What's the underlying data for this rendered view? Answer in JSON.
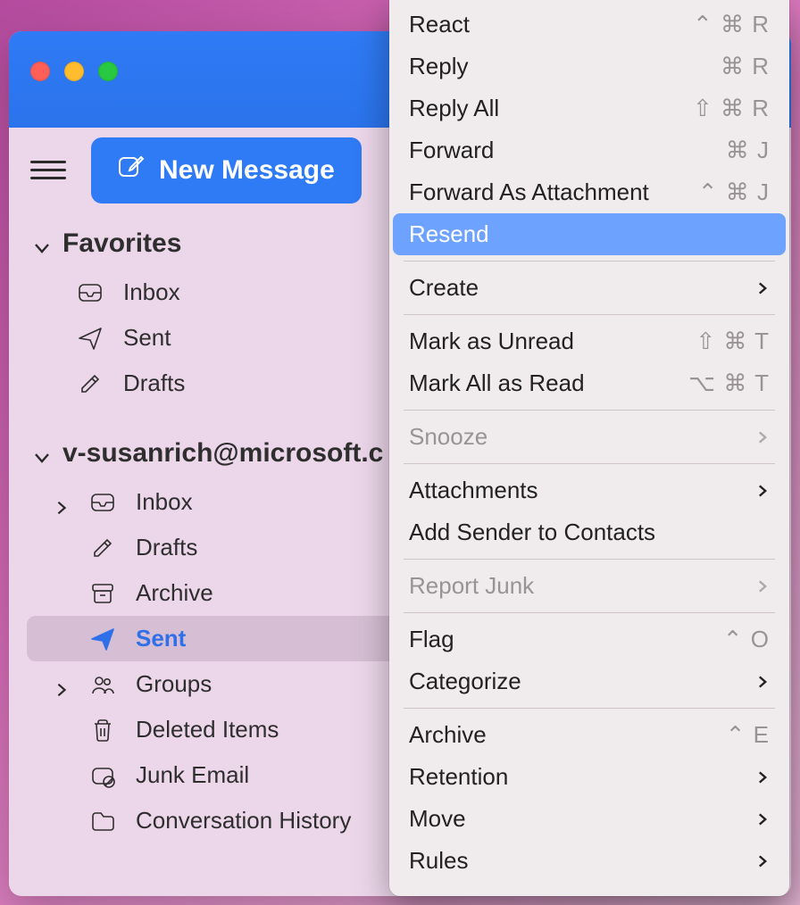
{
  "toolbar": {
    "new_message_label": "New Message"
  },
  "sidebar": {
    "favorites_label": "Favorites",
    "favorites": [
      {
        "label": "Inbox",
        "icon": "inbox"
      },
      {
        "label": "Sent",
        "icon": "sent"
      },
      {
        "label": "Drafts",
        "icon": "drafts"
      }
    ],
    "account_label": "v-susanrich@microsoft.c",
    "account_items": [
      {
        "label": "Inbox",
        "icon": "inbox",
        "chevron": true
      },
      {
        "label": "Drafts",
        "icon": "drafts"
      },
      {
        "label": "Archive",
        "icon": "archive"
      },
      {
        "label": "Sent",
        "icon": "sent",
        "selected": true
      },
      {
        "label": "Groups",
        "icon": "groups",
        "chevron": true
      },
      {
        "label": "Deleted Items",
        "icon": "trash"
      },
      {
        "label": "Junk Email",
        "icon": "junk"
      },
      {
        "label": "Conversation History",
        "icon": "folder"
      }
    ]
  },
  "context_menu": {
    "items": [
      {
        "label": "React",
        "shortcut": "⌃ ⌘ R"
      },
      {
        "label": "Reply",
        "shortcut": "⌘ R"
      },
      {
        "label": "Reply All",
        "shortcut": "⇧ ⌘ R"
      },
      {
        "label": "Forward",
        "shortcut": "⌘  J"
      },
      {
        "label": "Forward As Attachment",
        "shortcut": "⌃ ⌘  J"
      },
      {
        "label": "Resend",
        "highlight": true
      },
      {
        "sep": true
      },
      {
        "label": "Create",
        "submenu": true
      },
      {
        "sep": true
      },
      {
        "label": "Mark as Unread",
        "shortcut": "⇧ ⌘ T"
      },
      {
        "label": "Mark All as Read",
        "shortcut": "⌥ ⌘ T"
      },
      {
        "sep": true
      },
      {
        "label": "Snooze",
        "submenu": true,
        "disabled": true
      },
      {
        "sep": true
      },
      {
        "label": "Attachments",
        "submenu": true
      },
      {
        "label": "Add Sender to Contacts"
      },
      {
        "sep": true
      },
      {
        "label": "Report Junk",
        "submenu": true,
        "disabled": true
      },
      {
        "sep": true
      },
      {
        "label": "Flag",
        "shortcut": "⌃ O"
      },
      {
        "label": "Categorize",
        "submenu": true
      },
      {
        "sep": true
      },
      {
        "label": "Archive",
        "shortcut": "⌃ E"
      },
      {
        "label": "Retention",
        "submenu": true
      },
      {
        "label": "Move",
        "submenu": true
      },
      {
        "label": "Rules",
        "submenu": true
      }
    ]
  }
}
